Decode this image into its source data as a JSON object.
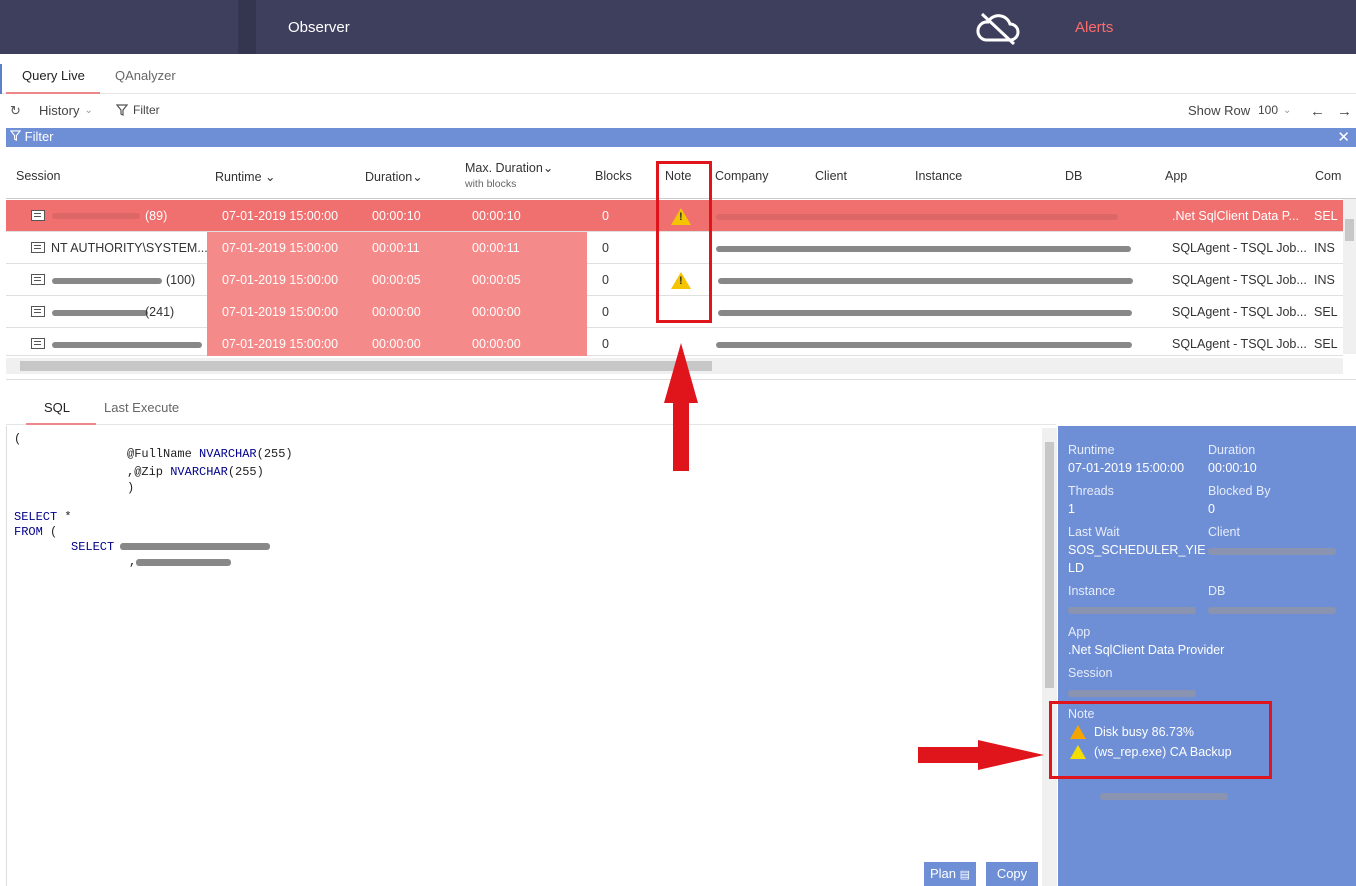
{
  "topbar": {
    "app_name": "Observer",
    "alerts_label": "Alerts",
    "cloud_icon": "cloud-off-icon"
  },
  "tabs": [
    {
      "label": "Query Live"
    },
    {
      "label": "QAnalyzer"
    }
  ],
  "toolbar": {
    "history_label": "History",
    "filter_label": "Filter",
    "show_row_label": "Show Row",
    "show_row_value": "100"
  },
  "filterbar": {
    "label": "Filter",
    "close": "✕"
  },
  "grid": {
    "headers": {
      "session": "Session",
      "runtime": "Runtime",
      "duration": "Duration",
      "max_duration": "Max. Duration",
      "max_duration_sub": "with blocks",
      "blocks": "Blocks",
      "note": "Note",
      "company": "Company",
      "client": "Client",
      "instance": "Instance",
      "db": "DB",
      "app": "App",
      "com": "Com"
    },
    "rows": [
      {
        "session": "(89)",
        "runtime": "07-01-2019 15:00:00",
        "duration": "00:00:10",
        "max_duration": "00:00:10",
        "blocks": "0",
        "note": true,
        "app": ".Net SqlClient Data P...",
        "com": "SEL"
      },
      {
        "session": "NT AUTHORITY\\SYSTEM...",
        "runtime": "07-01-2019 15:00:00",
        "duration": "00:00:11",
        "max_duration": "00:00:11",
        "blocks": "0",
        "note": false,
        "app": "SQLAgent - TSQL Job...",
        "com": "INS"
      },
      {
        "session": "(100)",
        "runtime": "07-01-2019 15:00:00",
        "duration": "00:00:05",
        "max_duration": "00:00:05",
        "blocks": "0",
        "note": true,
        "app": "SQLAgent - TSQL Job...",
        "com": "INS"
      },
      {
        "session": "(241)",
        "runtime": "07-01-2019 15:00:00",
        "duration": "00:00:00",
        "max_duration": "00:00:00",
        "blocks": "0",
        "note": false,
        "app": "SQLAgent - TSQL Job...",
        "com": "SEL"
      },
      {
        "session": "",
        "runtime": "07-01-2019 15:00:00",
        "duration": "00:00:00",
        "max_duration": "00:00:00",
        "blocks": "0",
        "note": false,
        "app": "SQLAgent - TSQL Job...",
        "com": "SEL"
      }
    ]
  },
  "bottom_tabs": [
    {
      "label": "SQL"
    },
    {
      "label": "Last Execute"
    }
  ],
  "sql": {
    "line1": "(",
    "line2_var": "@FullName",
    "line2_type": "NVARCHAR",
    "line2_args": "(255)",
    "line3_var": ",@Zip",
    "line3_type": "NVARCHAR",
    "line3_args": "(255)",
    "line4": ")",
    "line5_kw": "SELECT",
    "line5_rest": " *",
    "line6_kw": "FROM",
    "line6_rest": " (",
    "line7_kw": "SELECT",
    "line8": ","
  },
  "buttons": {
    "plan": "Plan",
    "copy": "Copy"
  },
  "details": {
    "runtime_label": "Runtime",
    "runtime_value": "07-01-2019 15:00:00",
    "duration_label": "Duration",
    "duration_value": "00:00:10",
    "threads_label": "Threads",
    "threads_value": "1",
    "blocked_by_label": "Blocked By",
    "blocked_by_value": "0",
    "last_wait_label": "Last Wait",
    "last_wait_value_1": "SOS_SCHEDULER_YIE",
    "last_wait_value_2": "LD",
    "client_label": "Client",
    "instance_label": "Instance",
    "db_label": "DB",
    "app_label": "App",
    "app_value": ".Net SqlClient Data Provider",
    "session_label": "Session",
    "note_label": "Note",
    "notes": [
      "Disk busy 86.73%",
      "(ws_rep.exe) CA Backup"
    ]
  }
}
